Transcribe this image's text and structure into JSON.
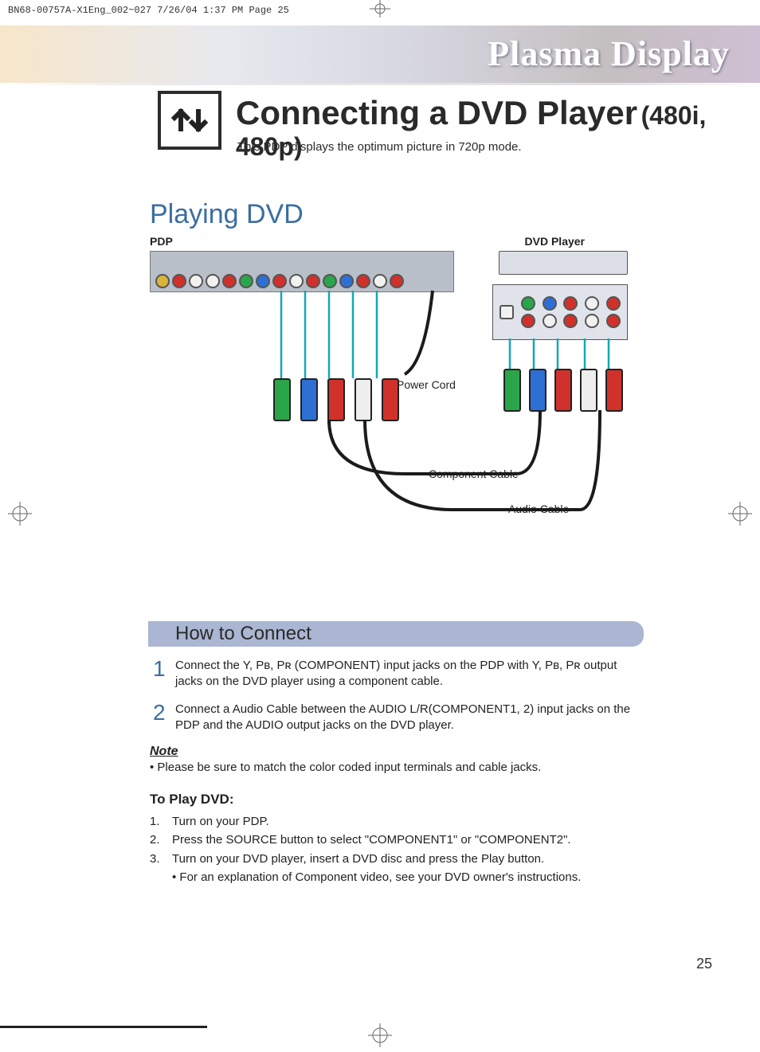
{
  "print_header": "BN68-00757A-X1Eng_002~027  7/26/04  1:37 PM  Page 25",
  "banner_title": "Plasma Display",
  "page_title_main": "Connecting a DVD Player",
  "page_title_sub": "(480i, 480p)",
  "page_subtitle": "This PDP displays the optimum picture in 720p mode.",
  "section_playing": "Playing DVD",
  "diagram": {
    "pdp_label": "PDP",
    "dvd_label": "DVD Player",
    "power_cord": "Power Cord",
    "component_cable": "Component Cable",
    "audio_cable": "Audio Cable"
  },
  "howto": {
    "heading": "How to Connect",
    "steps": [
      {
        "n": "1",
        "text": "Connect the Y, Pʙ, Pʀ (COMPONENT) input jacks on the PDP with Y, Pʙ, Pʀ output jacks on the DVD player using a component cable."
      },
      {
        "n": "2",
        "text": "Connect a Audio Cable between the AUDIO L/R(COMPONENT1, 2) input jacks on the PDP and the AUDIO output jacks on the DVD player."
      }
    ],
    "note_h": "Note",
    "note_text": "•  Please be sure to match the color coded input terminals and cable jacks.",
    "toplay_h": "To Play DVD:",
    "toplay": [
      {
        "n": "1.",
        "text": "Turn on your PDP."
      },
      {
        "n": "2.",
        "text": "Press the SOURCE button to select \"COMPONENT1\" or \"COMPONENT2\"."
      },
      {
        "n": "3.",
        "text": "Turn on your DVD player, insert a DVD disc and press the Play button."
      }
    ],
    "toplay_sub": "• For an explanation of Component video, see your DVD owner's instructions."
  },
  "page_number": "25"
}
